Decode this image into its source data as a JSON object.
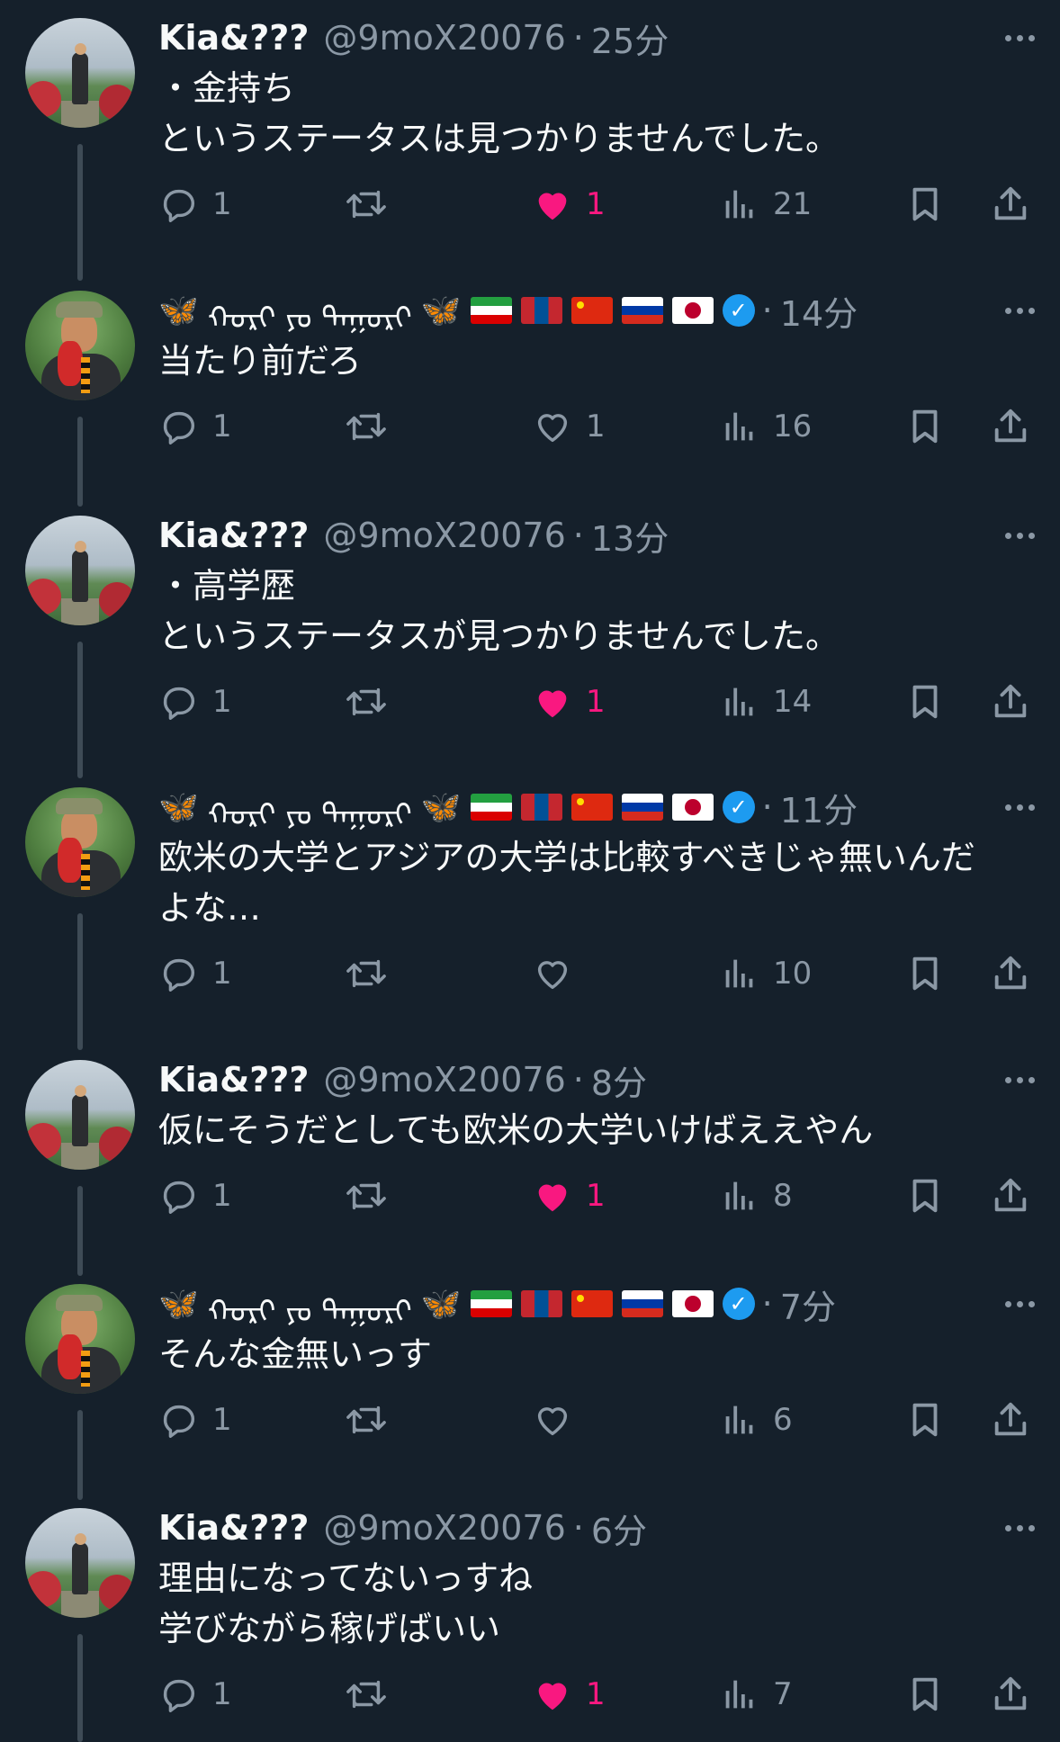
{
  "tweets": [
    {
      "author_type": "kia",
      "display_name": "Kia&???",
      "handle": "@9moX20076",
      "separator": "·",
      "time": "25分",
      "text": "・金持ち\nというステータスは見つかりませんでした。",
      "replies": "1",
      "likes": "1",
      "liked": true,
      "views": "21"
    },
    {
      "author_type": "mil",
      "display_name_script": "ᠬᠣᠷᠢ ᠶᠣ ᠲᠠᠭᠤᠷᠢ",
      "separator": "·",
      "time": "14分",
      "text": "当たり前だろ",
      "replies": "1",
      "likes": "1",
      "liked": false,
      "views": "16"
    },
    {
      "author_type": "kia",
      "display_name": "Kia&???",
      "handle": "@9moX20076",
      "separator": "·",
      "time": "13分",
      "text": "・高学歴\nというステータスが見つかりませんでした。",
      "replies": "1",
      "likes": "1",
      "liked": true,
      "views": "14"
    },
    {
      "author_type": "mil",
      "display_name_script": "ᠬᠣᠷᠢ ᠶᠣ ᠲᠠᠭᠤᠷᠢ",
      "separator": "·",
      "time": "11分",
      "text": "欧米の大学とアジアの大学は比較すべきじゃ無いんだ\nよな…",
      "replies": "1",
      "likes": "",
      "liked": false,
      "views": "10"
    },
    {
      "author_type": "kia",
      "display_name": "Kia&???",
      "handle": "@9moX20076",
      "separator": "·",
      "time": "8分",
      "text": "仮にそうだとしても欧米の大学いけばええやん",
      "replies": "1",
      "likes": "1",
      "liked": true,
      "views": "8"
    },
    {
      "author_type": "mil",
      "display_name_script": "ᠬᠣᠷᠢ ᠶᠣ ᠲᠠᠭᠤᠷᠢ",
      "separator": "·",
      "time": "7分",
      "text": "そんな金無いっす",
      "replies": "1",
      "likes": "",
      "liked": false,
      "views": "6"
    },
    {
      "author_type": "kia",
      "display_name": "Kia&???",
      "handle": "@9moX20076",
      "separator": "·",
      "time": "6分",
      "text": "理由になってないっすね\n学びながら稼げばいい",
      "replies": "1",
      "likes": "1",
      "liked": true,
      "views": "7"
    }
  ],
  "icons": {
    "reply": "reply-icon",
    "retweet": "retweet-icon",
    "like": "heart-icon",
    "views": "views-icon",
    "bookmark": "bookmark-icon",
    "share": "share-icon",
    "more": "more-icon",
    "verified": "verified-badge-icon",
    "butterfly": "butterfly-icon"
  },
  "colors": {
    "background": "#15202b",
    "text_primary": "#f7f9f9",
    "text_secondary": "#8b98a5",
    "like_active": "#f91880",
    "verified": "#1d9bf0",
    "thread_line": "#3e4b56"
  }
}
